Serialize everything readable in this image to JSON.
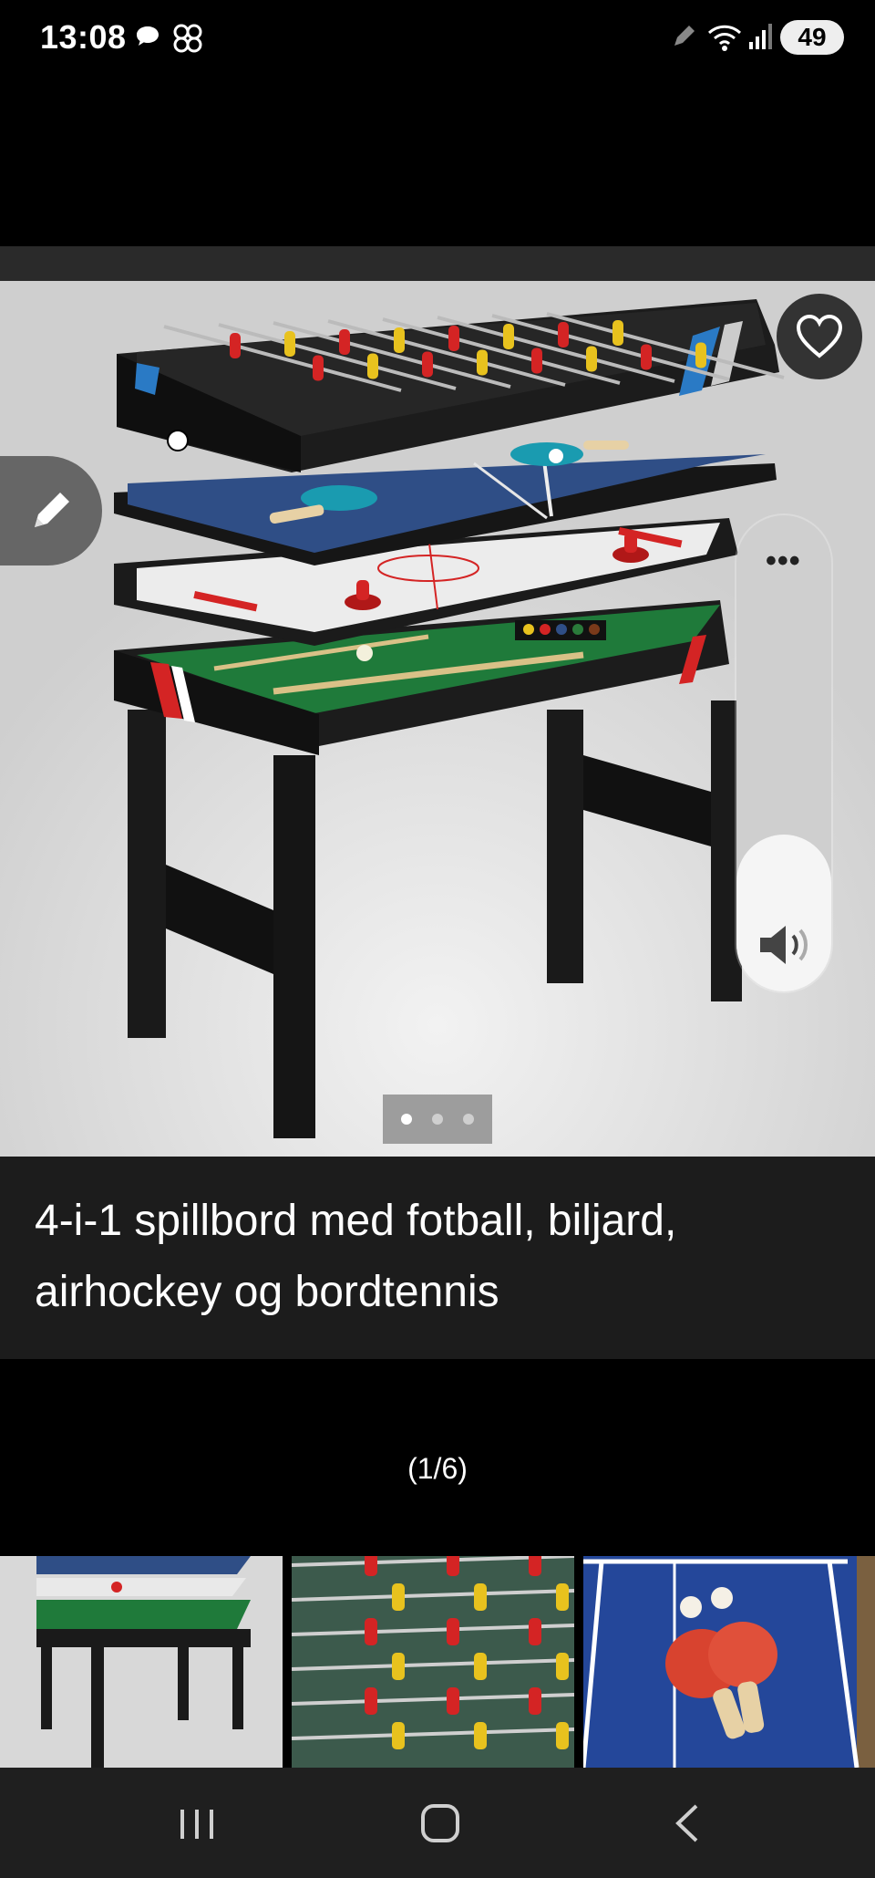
{
  "status_bar": {
    "time": "13:08",
    "battery": "49",
    "icons": [
      "chat-bubble-icon",
      "pinwheel-icon",
      "pen-icon",
      "wifi-icon",
      "signal-icon"
    ]
  },
  "product": {
    "title": "4-i-1 spillbord med fotball, biljard, airhockey og bordtennis",
    "image_counter": "(1/6)",
    "carousel_active_index": 0,
    "carousel_dot_count": 3,
    "favorite_icon": "heart-icon",
    "edit_icon": "pencil-icon"
  },
  "volume_panel": {
    "more_label": "•••",
    "speaker_icon": "speaker-icon",
    "level": 0.33
  },
  "thumbnails": [
    {
      "name": "thumbnail-multigame-table"
    },
    {
      "name": "thumbnail-foosball-closeup"
    },
    {
      "name": "thumbnail-table-tennis"
    }
  ],
  "nav_bar": {
    "icons": [
      "recents-icon",
      "home-icon",
      "back-icon"
    ]
  },
  "colors": {
    "background": "#000000",
    "panel": "#1c1c1c",
    "image_bg": "#d6d6d6",
    "felt_green": "#1f7a3a",
    "table_blue": "#2f4e86",
    "accent_red": "#d42424",
    "accent_yellow": "#e8c21e"
  }
}
